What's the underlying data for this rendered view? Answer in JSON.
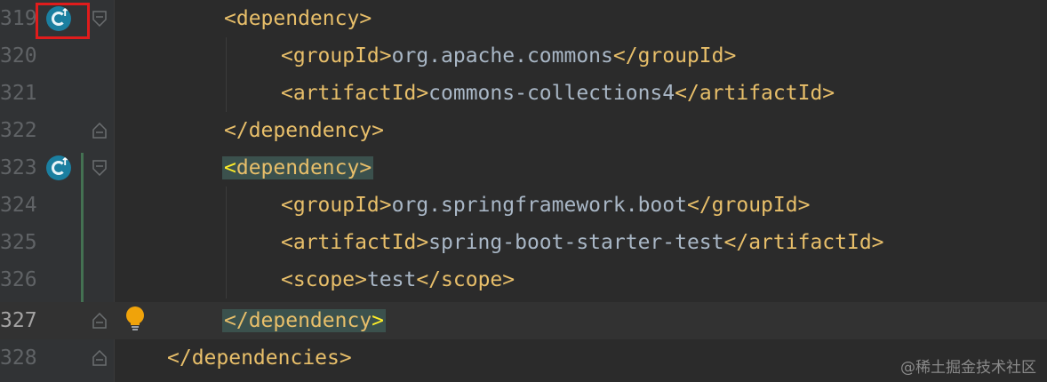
{
  "editor": {
    "lines": [
      {
        "num": "319",
        "open": "<dependency>",
        "text": "",
        "close": ""
      },
      {
        "num": "320",
        "open": "<groupId>",
        "text": "org.apache.commons",
        "close": "</groupId>"
      },
      {
        "num": "321",
        "open": "<artifactId>",
        "text": "commons-collections4",
        "close": "</artifactId>"
      },
      {
        "num": "322",
        "open": "</dependency>",
        "text": "",
        "close": ""
      },
      {
        "num": "323",
        "open": "dependency>",
        "text": "",
        "close": ""
      },
      {
        "num": "324",
        "open": "<groupId>",
        "text": "org.springframework.boot",
        "close": "</groupId>"
      },
      {
        "num": "325",
        "open": "<artifactId>",
        "text": "spring-boot-starter-test",
        "close": "</artifactId>"
      },
      {
        "num": "326",
        "open": "<scope>",
        "text": "test",
        "close": "</scope>"
      },
      {
        "num": "327",
        "open": "</dependency",
        "text": "",
        "close": ""
      },
      {
        "num": "328",
        "open": "</dependencies>",
        "text": "",
        "close": ""
      }
    ],
    "current_line": "327",
    "gutter_icons": [
      "maven-dependency-icon",
      "maven-dependency-icon",
      "intention-bulb-icon"
    ]
  },
  "watermark": "@稀土掘金技术社区",
  "colors": {
    "background": "#2b2b2b",
    "gutter": "#313335",
    "tag": "#e8bf6a",
    "text": "#a9b7c6",
    "brace_match_bg": "#3b514d",
    "brace_match_fg": "#ffef28",
    "annotation_box": "#e01c1c",
    "vcs_added": "#447152"
  }
}
